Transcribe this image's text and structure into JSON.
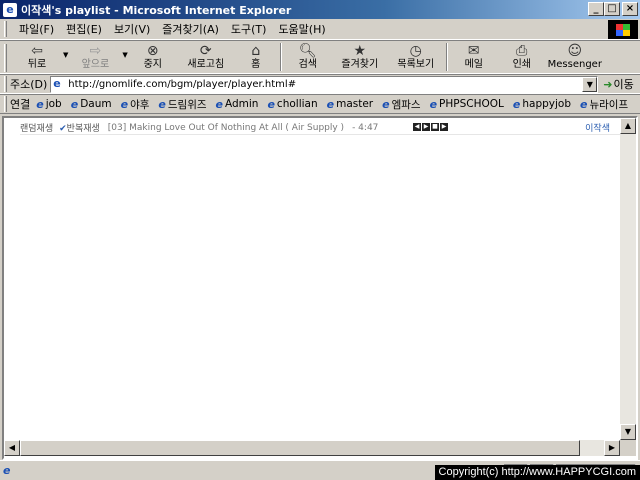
{
  "window": {
    "title": "이작색's playlist - Microsoft Internet Explorer",
    "min": "_",
    "max": "□",
    "close": "×"
  },
  "menu": [
    "파일(F)",
    "편집(E)",
    "보기(V)",
    "즐겨찾기(A)",
    "도구(T)",
    "도움말(H)"
  ],
  "toolbar": {
    "back": "뒤로",
    "forward": "앞으로",
    "stop": "중지",
    "refresh": "새로고침",
    "home": "홈",
    "search": "검색",
    "favorites": "즐겨찾기",
    "history": "목록보기",
    "mail": "메일",
    "print": "인쇄",
    "messenger": "Messenger"
  },
  "address": {
    "label": "주소(D)",
    "url": "http://gnomlife.com/bgm/player/player.html#",
    "go": "이동"
  },
  "links": {
    "label": "연결",
    "items": [
      "job",
      "Daum",
      "야후",
      "드림위즈",
      "Admin",
      "chollian",
      "master",
      "엠파스",
      "PHPSCHOOL",
      "happyjob",
      "뉴라이프"
    ]
  },
  "player": {
    "mode": "랜덤재생",
    "repeat": "반복재생",
    "track": "[03] Making Love Out Of Nothing At All ( Air Supply )",
    "time": "- 4:47",
    "owner": "이작색"
  },
  "copyright": "Copyright(c) http://www.HAPPYCGI.com"
}
